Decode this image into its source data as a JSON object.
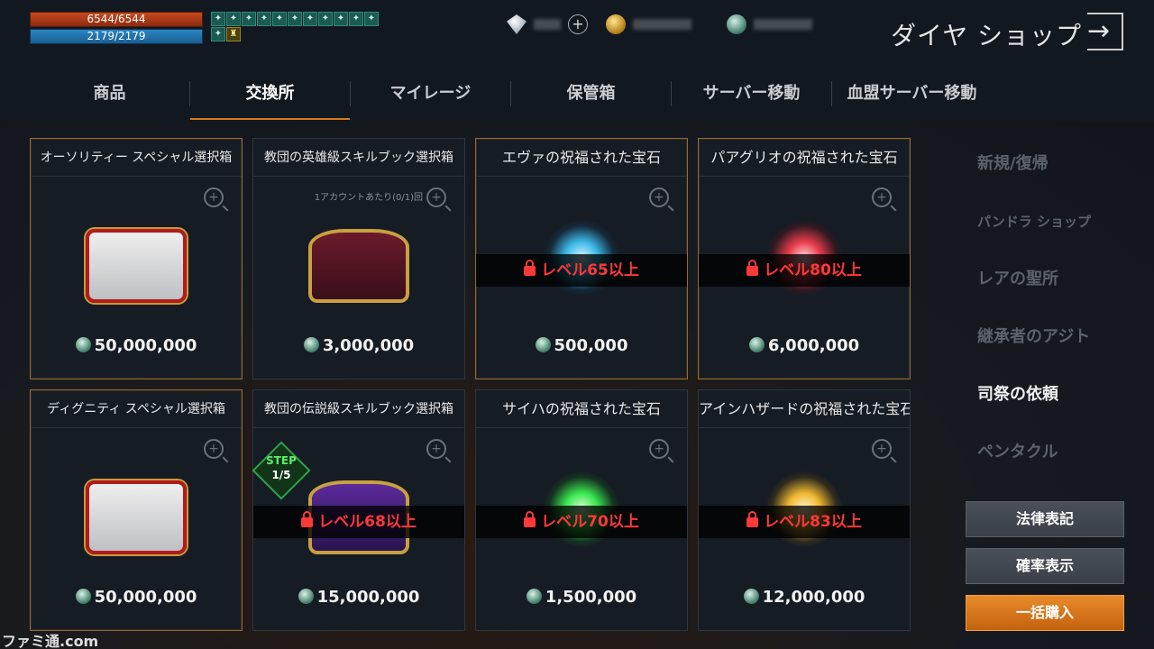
{
  "status": {
    "hp": "6544/6544",
    "mp": "2179/2179",
    "buff_icons": [
      "buff-icon",
      "buff-icon",
      "buff-icon",
      "buff-icon",
      "buff-icon",
      "buff-icon",
      "buff-icon",
      "buff-icon",
      "buff-icon",
      "buff-icon",
      "buff-icon",
      "buff-icon",
      "buff-icon"
    ]
  },
  "header": {
    "title": "ダイヤ ショップ",
    "plus_label": "+",
    "exit_label": "→"
  },
  "tabs": [
    "商品",
    "交換所",
    "マイレージ",
    "保管箱",
    "サーバー移動",
    "血盟サーバー移動"
  ],
  "active_tab": "交換所",
  "cards": [
    {
      "name": "オーソリティー スペシャル選択箱",
      "price": "50,000,000",
      "item": "chest-red",
      "lock": "",
      "limit": "",
      "highlight": true
    },
    {
      "name": "教団の英雄級スキルブック選択箱",
      "price": "3,000,000",
      "item": "chest-brown",
      "lock": "",
      "limit": "1アカウントあたり(0/1)回",
      "highlight": false
    },
    {
      "name": "エヴァの祝福された宝石",
      "price": "500,000",
      "item": "gem-blue",
      "lock": "レベル65以上",
      "limit": "",
      "highlight": true
    },
    {
      "name": "パアグリオの祝福された宝石",
      "price": "6,000,000",
      "item": "gem-red",
      "lock": "レベル80以上",
      "limit": "",
      "highlight": true
    },
    {
      "name": "ディグニティ スペシャル選択箱",
      "price": "50,000,000",
      "item": "chest-red",
      "lock": "",
      "limit": "",
      "highlight": true
    },
    {
      "name": "教団の伝説級スキルブック選択箱",
      "price": "15,000,000",
      "item": "chest-purple",
      "lock": "レベル68以上",
      "limit": "",
      "step": [
        "STEP",
        "1/5"
      ],
      "highlight": false
    },
    {
      "name": "サイハの祝福された宝石",
      "price": "1,500,000",
      "item": "gem-green",
      "lock": "レベル70以上",
      "limit": "",
      "highlight": false
    },
    {
      "name": "アインハザードの祝福された宝石",
      "price": "12,000,000",
      "item": "gem-yellow",
      "lock": "レベル83以上",
      "limit": "",
      "highlight": false
    }
  ],
  "side_menu": [
    "新規/復帰",
    "パンドラ ショップ",
    "レアの聖所",
    "継承者のアジト",
    "司祭の依頼",
    "ペンタクル"
  ],
  "side_menu_active": "司祭の依頼",
  "buttons": {
    "legal": "法律表記",
    "probability": "確率表示",
    "bulk_buy": "一括購入"
  },
  "watermark": "ファミ通.com",
  "colors": {
    "accent": "#d87a1a",
    "lock_red": "#ff3838",
    "buy_orange": "#e88a2a"
  }
}
